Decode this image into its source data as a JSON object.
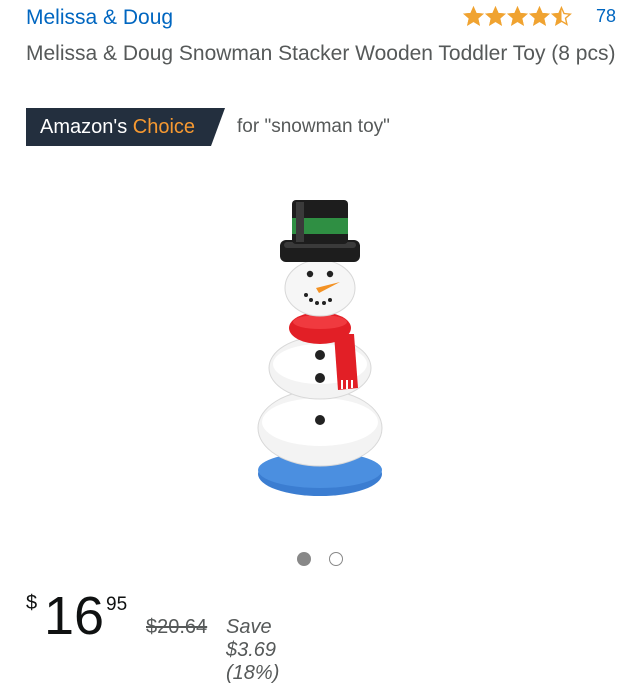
{
  "brand": {
    "name": "Melissa & Doug",
    "color": "#0066c0"
  },
  "rating": {
    "stars": 4.5,
    "max_stars": 5,
    "star_color": "#f0a331",
    "review_count": "78"
  },
  "product": {
    "title": "Melissa & Doug Snowman Stacker Wooden Toddler Toy (8 pcs)"
  },
  "choice": {
    "label_prefix": "Amazon's",
    "label_accent": "Choice",
    "query": "for \"snowman toy\"",
    "badge_color": "#232f3e",
    "accent_color": "#f69931"
  },
  "image": {
    "icon": "snowman-toy-image",
    "carousel": {
      "total": 2,
      "current": 1
    }
  },
  "price": {
    "currency": "$",
    "whole": "16",
    "fraction": "95",
    "list_price": "$20.64",
    "savings": "Save $3.69 (18%)"
  }
}
